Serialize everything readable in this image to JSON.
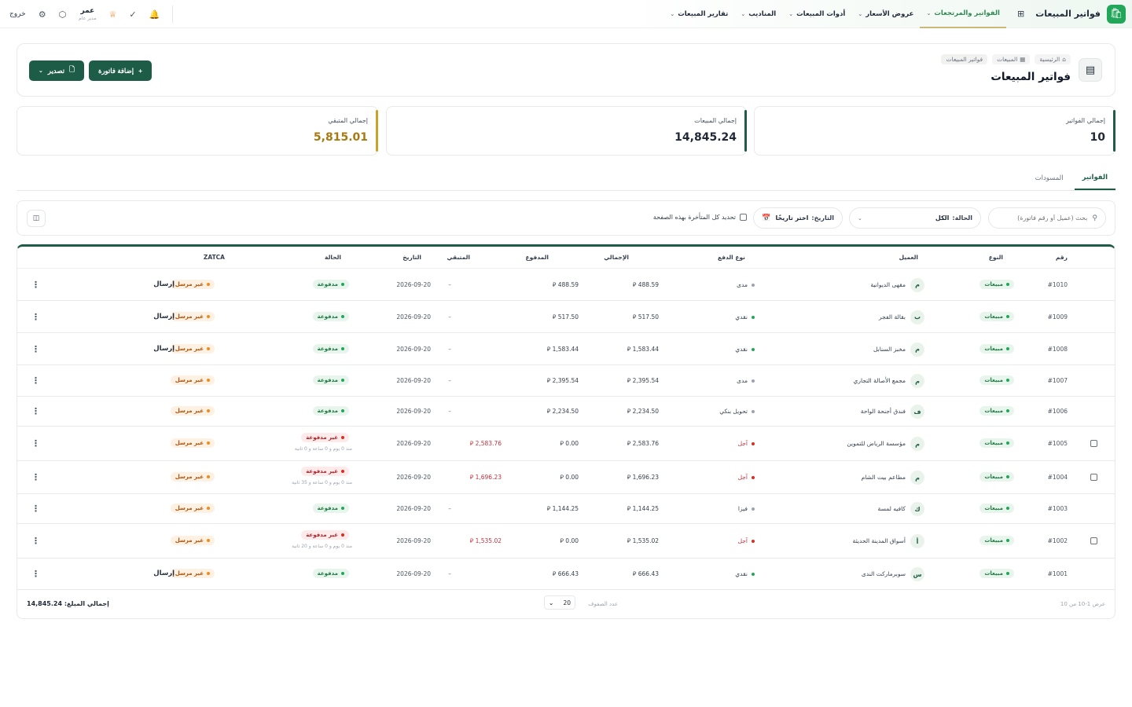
{
  "nav": {
    "brand": "فواتير المبيعات",
    "items": [
      {
        "label": "الفواتير والمرتجعات",
        "active": true
      },
      {
        "label": "عروض الأسعار",
        "active": false
      },
      {
        "label": "أدوات المبيعات",
        "active": false
      },
      {
        "label": "المناديب",
        "active": false
      },
      {
        "label": "تقارير المبيعات",
        "active": false
      }
    ],
    "user_name": "عمر",
    "user_role": "مدير عام",
    "logout": "خروج"
  },
  "header": {
    "breadcrumb": [
      "الرئيسية",
      "المبيعات",
      "فواتير المبيعات"
    ],
    "title": "فواتير المبيعات",
    "export_label": "تصدير",
    "add_label": "إضافة فاتورة"
  },
  "stats": [
    {
      "label": "إجمالي الفواتير",
      "value": "10",
      "accent": "#1d5c47"
    },
    {
      "label": "إجمالي المبيعات",
      "value": "14,845.24",
      "accent": "#1d5c47"
    },
    {
      "label": "إجمالي المتبقي",
      "value": "5,815.01",
      "accent": "#c9a227"
    }
  ],
  "tabs": [
    "الفواتير",
    "المسودات"
  ],
  "filters": {
    "search_placeholder": "بحث (عميل أو رقم فاتورة)",
    "status_label": "الحالة:",
    "status_value": "الكل",
    "date_label": "التاريخ:",
    "date_value": "اختر تاريخًا",
    "late_label": "تحديد كل المتأخرة بهذه الصفحة"
  },
  "table": {
    "headers": {
      "number": "رقم",
      "type": "النوع",
      "customer": "العميل",
      "payment": "نوع الدفع",
      "total": "الإجمالي",
      "paid": "المدفوع",
      "remaining": "المتبقي",
      "date": "التاريخ",
      "status": "الحالة",
      "zatca": "ZATCA"
    },
    "currency": "⃁",
    "rows": [
      {
        "num": "#1010",
        "type": "مبيعات",
        "initial": "م",
        "customer": "مقهى الديوانية",
        "payment": "مدى",
        "pay_color": "#9ca3af",
        "total": "488.59",
        "paid": "488.59",
        "remaining": "–",
        "date": "2026-09-20",
        "status": "مدفوعة",
        "status_kind": "paid",
        "note": "",
        "zatca": "غير مرسل",
        "send": "إرسال",
        "checkbox": false
      },
      {
        "num": "#1009",
        "type": "مبيعات",
        "initial": "ب",
        "customer": "بقالة الفجر",
        "payment": "نقدي",
        "pay_color": "#22a65a",
        "total": "517.50",
        "paid": "517.50",
        "remaining": "–",
        "date": "2026-09-20",
        "status": "مدفوعة",
        "status_kind": "paid",
        "note": "",
        "zatca": "غير مرسل",
        "send": "إرسال",
        "checkbox": false
      },
      {
        "num": "#1008",
        "type": "مبيعات",
        "initial": "م",
        "customer": "مخبز السنابل",
        "payment": "نقدي",
        "pay_color": "#22a65a",
        "total": "1,583.44",
        "paid": "1,583.44",
        "remaining": "–",
        "date": "2026-09-20",
        "status": "مدفوعة",
        "status_kind": "paid",
        "note": "",
        "zatca": "غير مرسل",
        "send": "إرسال",
        "checkbox": false
      },
      {
        "num": "#1007",
        "type": "مبيعات",
        "initial": "م",
        "customer": "مجمع الأصالة التجاري",
        "payment": "مدى",
        "pay_color": "#9ca3af",
        "total": "2,395.54",
        "paid": "2,395.54",
        "remaining": "–",
        "date": "2026-09-20",
        "status": "مدفوعة",
        "status_kind": "paid",
        "note": "",
        "zatca": "غير مرسل",
        "send": "",
        "checkbox": false
      },
      {
        "num": "#1006",
        "type": "مبيعات",
        "initial": "ف",
        "customer": "فندق أجنحة الواحة",
        "payment": "تحويل بنكي",
        "pay_color": "#9ca3af",
        "total": "2,234.50",
        "paid": "2,234.50",
        "remaining": "–",
        "date": "2026-09-20",
        "status": "مدفوعة",
        "status_kind": "paid",
        "note": "",
        "zatca": "غير مرسل",
        "send": "",
        "checkbox": false
      },
      {
        "num": "#1005",
        "type": "مبيعات",
        "initial": "م",
        "customer": "مؤسسة الرياض للتموين",
        "payment": "آجل",
        "pay_color": "#d92d20",
        "total": "2,583.76",
        "paid": "0.00",
        "remaining": "2,583.76",
        "date": "2026-09-20",
        "status": "غير مدفوعة",
        "status_kind": "unpaid",
        "note": "منذ 0 يوم و 0 ساعة و 0 ثانية",
        "zatca": "غير مرسل",
        "send": "",
        "checkbox": true
      },
      {
        "num": "#1004",
        "type": "مبيعات",
        "initial": "م",
        "customer": "مطاعم بيت الشام",
        "payment": "آجل",
        "pay_color": "#d92d20",
        "total": "1,696.23",
        "paid": "0.00",
        "remaining": "1,696.23",
        "date": "2026-09-20",
        "status": "غير مدفوعة",
        "status_kind": "unpaid",
        "note": "منذ 0 يوم و 0 ساعة و 35 ثانية",
        "zatca": "غير مرسل",
        "send": "",
        "checkbox": true
      },
      {
        "num": "#1003",
        "type": "مبيعات",
        "initial": "ك",
        "customer": "كافيه لمسة",
        "payment": "فيزا",
        "pay_color": "#9ca3af",
        "total": "1,144.25",
        "paid": "1,144.25",
        "remaining": "–",
        "date": "2026-09-20",
        "status": "مدفوعة",
        "status_kind": "paid",
        "note": "",
        "zatca": "غير مرسل",
        "send": "",
        "checkbox": false
      },
      {
        "num": "#1002",
        "type": "مبيعات",
        "initial": "أ",
        "customer": "أسواق المدينة الحديثة",
        "payment": "آجل",
        "pay_color": "#d92d20",
        "total": "1,535.02",
        "paid": "0.00",
        "remaining": "1,535.02",
        "date": "2026-09-20",
        "status": "غير مدفوعة",
        "status_kind": "unpaid",
        "note": "منذ 0 يوم و 0 ساعة و 20 ثانية",
        "zatca": "غير مرسل",
        "send": "",
        "checkbox": true
      },
      {
        "num": "#1001",
        "type": "مبيعات",
        "initial": "س",
        "customer": "سوبرماركت الندى",
        "payment": "نقدي",
        "pay_color": "#22a65a",
        "total": "666.43",
        "paid": "666.43",
        "remaining": "–",
        "date": "2026-09-20",
        "status": "مدفوعة",
        "status_kind": "paid",
        "note": "",
        "zatca": "غير مرسل",
        "send": "إرسال",
        "checkbox": false
      }
    ]
  },
  "footer": {
    "range": "عرض 1-10 من 10",
    "rows_label": "عدد الصفوف",
    "rows_value": "20",
    "total_label": "إجمالي المبلغ:",
    "total_value": "14,845.24"
  }
}
